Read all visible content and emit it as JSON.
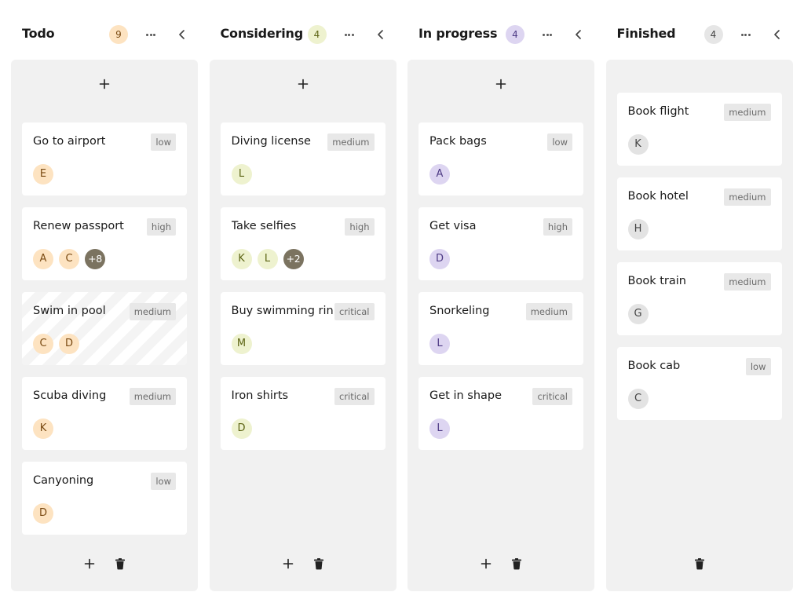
{
  "columns": [
    {
      "title": "Todo",
      "count": "9",
      "badge_color": "#fde3c1",
      "avatar_color": "#fde3c1",
      "avatar_text_color": "#7a4a12",
      "has_add_top": true,
      "has_add_footer": true,
      "cards": [
        {
          "title": "Go to airport",
          "priority": "low",
          "avatars": [
            "E"
          ]
        },
        {
          "title": "Renew passport",
          "priority": "high",
          "avatars": [
            "A",
            "C",
            "+8"
          ]
        },
        {
          "title": "Swim in pool",
          "priority": "medium",
          "avatars": [
            "C",
            "D"
          ],
          "striped": true
        },
        {
          "title": "Scuba diving",
          "priority": "medium",
          "avatars": [
            "K"
          ]
        },
        {
          "title": "Canyoning",
          "priority": "low",
          "avatars": [
            "D"
          ]
        }
      ]
    },
    {
      "title": "Considering",
      "count": "4",
      "badge_color": "#eef2cf",
      "avatar_color": "#eef2cf",
      "avatar_text_color": "#5c6414",
      "has_add_top": true,
      "has_add_footer": true,
      "cards": [
        {
          "title": "Diving license",
          "priority": "medium",
          "avatars": [
            "L"
          ]
        },
        {
          "title": "Take selfies",
          "priority": "high",
          "avatars": [
            "K",
            "L",
            "+2"
          ]
        },
        {
          "title": "Buy swimming rin",
          "priority": "critical",
          "avatars": [
            "M"
          ]
        },
        {
          "title": "Iron shirts",
          "priority": "critical",
          "avatars": [
            "D"
          ]
        }
      ]
    },
    {
      "title": "In progress",
      "count": "4",
      "badge_color": "#ddd5f1",
      "avatar_color": "#ddd5f1",
      "avatar_text_color": "#4d3a84",
      "has_add_top": true,
      "has_add_footer": true,
      "cards": [
        {
          "title": "Pack bags",
          "priority": "low",
          "avatars": [
            "A"
          ]
        },
        {
          "title": "Get visa",
          "priority": "high",
          "avatars": [
            "D"
          ]
        },
        {
          "title": "Snorkeling",
          "priority": "medium",
          "avatars": [
            "L"
          ]
        },
        {
          "title": "Get in shape",
          "priority": "critical",
          "avatars": [
            "L"
          ]
        }
      ]
    },
    {
      "title": "Finished",
      "count": "4",
      "badge_color": "#e6e6e6",
      "avatar_color": "#e3e3e3",
      "avatar_text_color": "#444444",
      "has_add_top": false,
      "has_add_footer": false,
      "cards": [
        {
          "title": "Book flight",
          "priority": "medium",
          "avatars": [
            "K"
          ]
        },
        {
          "title": "Book hotel",
          "priority": "medium",
          "avatars": [
            "H"
          ]
        },
        {
          "title": "Book train",
          "priority": "medium",
          "avatars": [
            "G"
          ]
        },
        {
          "title": "Book cab",
          "priority": "low",
          "avatars": [
            "C"
          ]
        }
      ]
    }
  ],
  "icons": {
    "more": "more-horizontal-icon",
    "collapse": "chevron-left-icon",
    "add": "plus-icon",
    "delete": "trash-icon"
  }
}
